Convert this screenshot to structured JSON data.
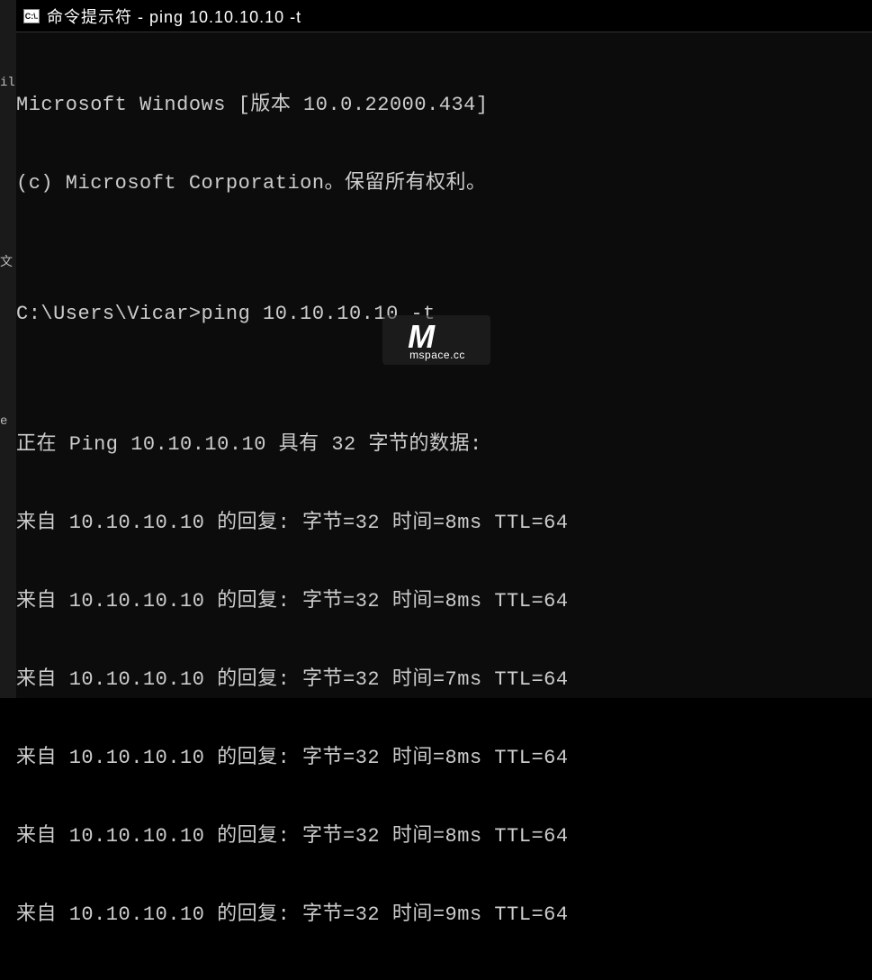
{
  "leftEdge": {
    "frag1": "il",
    "frag2": "文",
    "frag3": "e"
  },
  "window": {
    "title": "命令提示符 - ping  10.10.10.10 -t",
    "iconLabel": "C:\\."
  },
  "terminal": {
    "line1": "Microsoft Windows [版本 10.0.22000.434]",
    "line2": "(c) Microsoft Corporation。保留所有权利。",
    "blank1": "",
    "promptLine": "C:\\Users\\Vicar>ping 10.10.10.10 -t",
    "blank2": "",
    "pingHeader": "正在 Ping 10.10.10.10 具有 32 字节的数据:",
    "replies": [
      "来自 10.10.10.10 的回复: 字节=32 时间=8ms TTL=64",
      "来自 10.10.10.10 的回复: 字节=32 时间=8ms TTL=64",
      "来自 10.10.10.10 的回复: 字节=32 时间=7ms TTL=64",
      "来自 10.10.10.10 的回复: 字节=32 时间=8ms TTL=64",
      "来自 10.10.10.10 的回复: 字节=32 时间=8ms TTL=64",
      "来自 10.10.10.10 的回复: 字节=32 时间=9ms TTL=64"
    ]
  },
  "watermark": {
    "main": "M",
    "sub": "mspace.cc"
  }
}
